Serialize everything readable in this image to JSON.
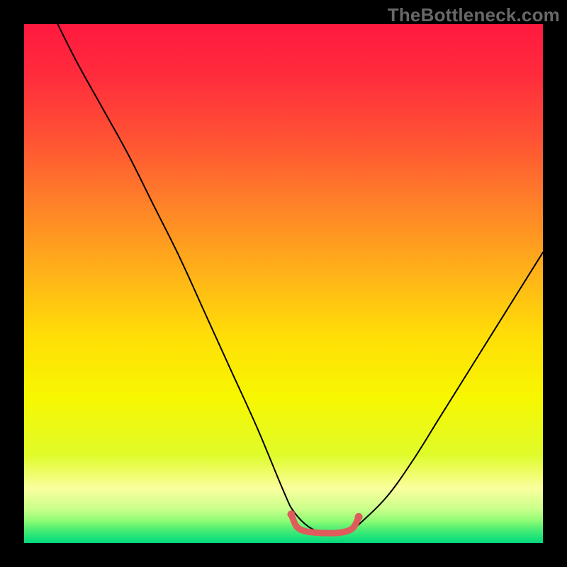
{
  "watermark": "TheBottleneck.com",
  "gradient": {
    "stops": [
      {
        "offset": 0.0,
        "color": "#ff193f"
      },
      {
        "offset": 0.1,
        "color": "#ff2c3c"
      },
      {
        "offset": 0.22,
        "color": "#ff5234"
      },
      {
        "offset": 0.35,
        "color": "#ff8228"
      },
      {
        "offset": 0.48,
        "color": "#ffb219"
      },
      {
        "offset": 0.6,
        "color": "#ffde07"
      },
      {
        "offset": 0.72,
        "color": "#f7f700"
      },
      {
        "offset": 0.83,
        "color": "#e0fb2a"
      },
      {
        "offset": 0.895,
        "color": "#faff9e"
      },
      {
        "offset": 0.935,
        "color": "#c9ff8a"
      },
      {
        "offset": 0.958,
        "color": "#8dfb74"
      },
      {
        "offset": 0.975,
        "color": "#49ed74"
      },
      {
        "offset": 0.99,
        "color": "#1de27a"
      },
      {
        "offset": 1.0,
        "color": "#04d97c"
      }
    ]
  },
  "chart_data": {
    "type": "line",
    "title": "",
    "xlabel": "",
    "ylabel": "",
    "xlim": [
      0,
      100
    ],
    "ylim": [
      0,
      100
    ],
    "series": [
      {
        "name": "bottleneck-curve",
        "stroke": "#000000",
        "stroke_width": 2,
        "x": [
          5,
          10,
          15,
          20,
          25,
          30,
          35,
          40,
          45,
          50,
          52,
          55,
          58,
          60,
          63,
          65,
          70,
          75,
          80,
          85,
          90,
          95,
          100
        ],
        "y": [
          103,
          93,
          84,
          75,
          65,
          55,
          44,
          33,
          22,
          10,
          6,
          3,
          2,
          2,
          2.5,
          4,
          9,
          16,
          24,
          32,
          40,
          48,
          56
        ]
      },
      {
        "name": "optimal-band",
        "stroke": "#de5c5c",
        "stroke_width": 9,
        "x": [
          51.5,
          52.5,
          54,
          56,
          58,
          60,
          62,
          63.5,
          64.5
        ],
        "y": [
          5.5,
          3.2,
          2.3,
          2.0,
          1.9,
          1.9,
          2.2,
          3.0,
          5.0
        ]
      }
    ],
    "dots": [
      {
        "name": "optimal-start-dot",
        "x": 51.5,
        "y": 5.5,
        "r": 5.5,
        "fill": "#de5c5c"
      },
      {
        "name": "optimal-end-dot",
        "x": 64.5,
        "y": 5.0,
        "r": 5.5,
        "fill": "#de5c5c"
      }
    ]
  }
}
